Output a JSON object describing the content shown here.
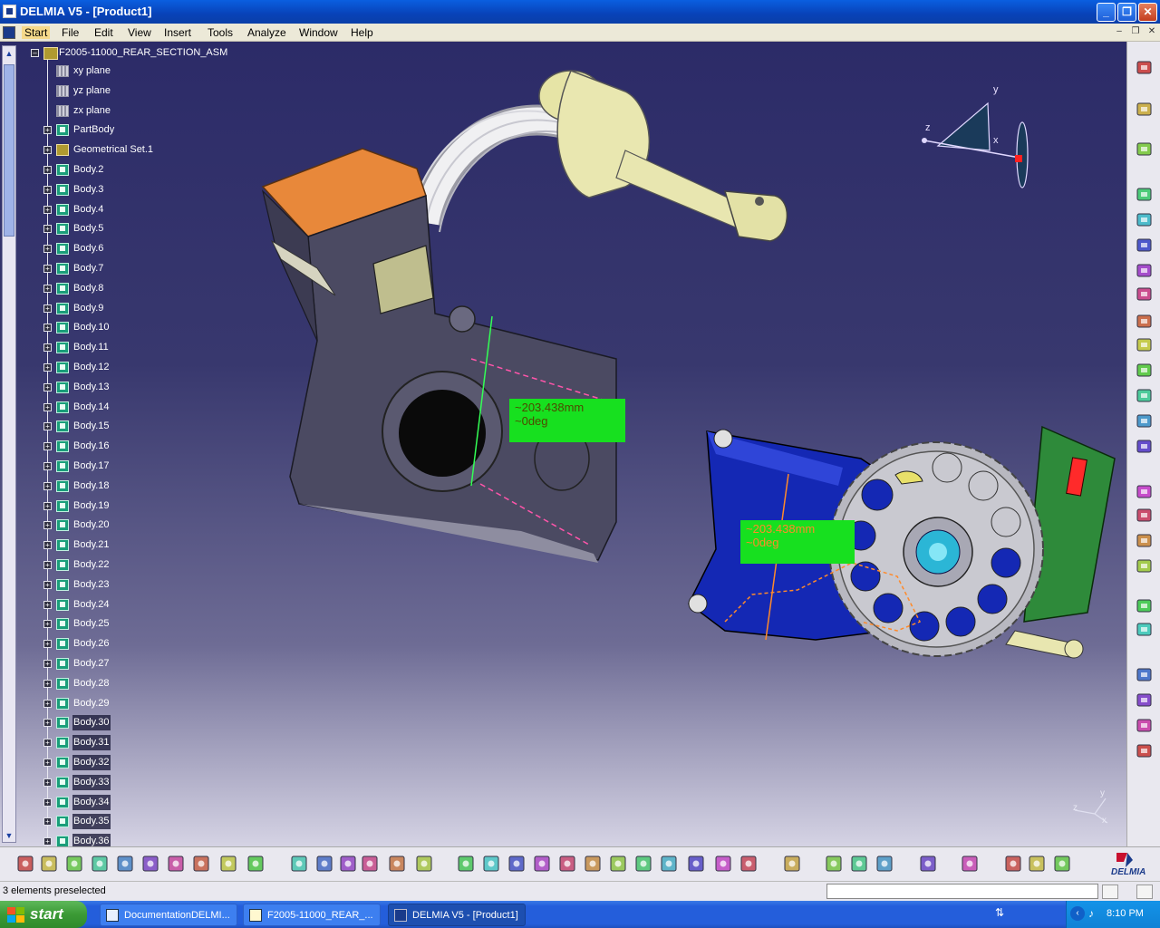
{
  "window": {
    "title": "DELMIA V5 - [Product1]"
  },
  "menu": {
    "items": [
      "Start",
      "File",
      "Edit",
      "View",
      "Insert",
      "Tools",
      "Analyze",
      "Window",
      "Help"
    ],
    "active": "Start"
  },
  "tree": {
    "root": "F2005-11000_REAR_SECTION_ASM",
    "planes": [
      "xy plane",
      "yz plane",
      "zx plane"
    ],
    "part_body": "PartBody",
    "geometrical_set": "Geometrical Set.1",
    "bodies": [
      "Body.2",
      "Body.3",
      "Body.4",
      "Body.5",
      "Body.6",
      "Body.7",
      "Body.8",
      "Body.9",
      "Body.10",
      "Body.11",
      "Body.12",
      "Body.13",
      "Body.14",
      "Body.15",
      "Body.16",
      "Body.17",
      "Body.18",
      "Body.19",
      "Body.20",
      "Body.21",
      "Body.22",
      "Body.23",
      "Body.24",
      "Body.25",
      "Body.26",
      "Body.27",
      "Body.28",
      "Body.29",
      "Body.30",
      "Body.31",
      "Body.32",
      "Body.33",
      "Body.34",
      "Body.35",
      "Body.36"
    ],
    "selected_bodies": [
      "Body.30",
      "Body.31",
      "Body.32",
      "Body.33",
      "Body.34",
      "Body.35",
      "Body.36"
    ]
  },
  "viewport": {
    "measure_1": {
      "distance": "~203.438mm",
      "angle": "~0deg"
    },
    "measure_2": {
      "distance": "~203.438mm",
      "angle": "~0deg"
    },
    "compass": {
      "axis_x": "x",
      "axis_y": "y",
      "axis_z": "z"
    },
    "triad": {
      "axis_x": "x",
      "axis_y": "y",
      "axis_z": "z"
    },
    "colors": {
      "bg_top": "#2c2b68",
      "bg_bottom": "#d5d3e4",
      "annotation_green": "#17e01f",
      "part_blue": "#1428b4",
      "part_orange": "#e88a3c",
      "part_green": "#2e8a3a"
    }
  },
  "status": {
    "message": "3 elements preselected",
    "command_input": ""
  },
  "brand": {
    "logo_text": "DELMIA"
  },
  "taskbar": {
    "start_label": "start",
    "items": [
      {
        "label": "DocumentationDELMI...",
        "active": false
      },
      {
        "label": "F2005-11000_REAR_...",
        "active": false
      },
      {
        "label": "DELMIA V5 - [Product1]",
        "active": true
      }
    ],
    "clock": "8:10 PM"
  }
}
